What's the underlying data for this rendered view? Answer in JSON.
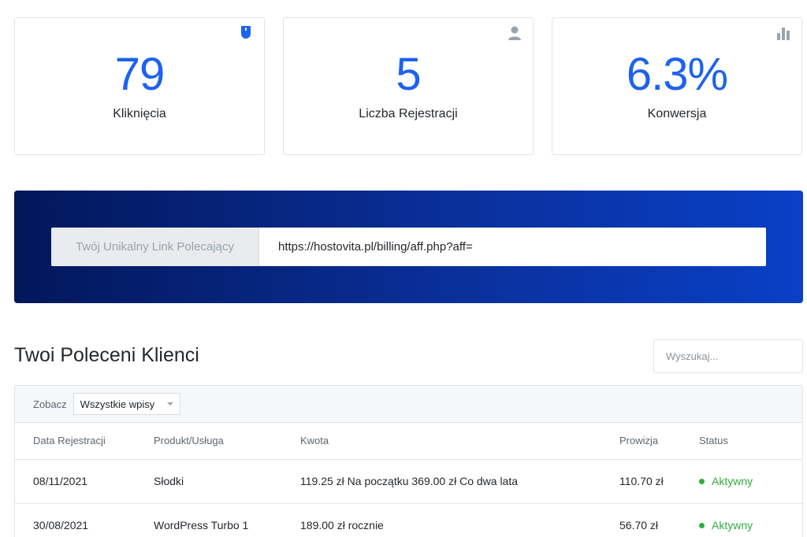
{
  "stats": [
    {
      "value": "79",
      "label": "Kliknięcia",
      "icon": "mouse-icon"
    },
    {
      "value": "5",
      "label": "Liczba Rejestracji",
      "icon": "user-icon"
    },
    {
      "value": "6.3%",
      "label": "Konwersja",
      "icon": "bar-chart-icon"
    }
  ],
  "referral": {
    "addon_label": "Twój Unikalny Link Polecający",
    "link": "https://hostovita.pl/billing/aff.php?aff="
  },
  "clients": {
    "title": "Twoi Poleceni Klienci",
    "search_placeholder": "Wyszukaj...",
    "show_label": "Zobacz",
    "show_selected": "Wszystkie wpisy",
    "columns": [
      "Data Rejestracji",
      "Produkt/Usługa",
      "Kwota",
      "Prowizja",
      "Status"
    ],
    "rows": [
      {
        "date": "08/11/2021",
        "product": "Słodki",
        "amount": "119.25 zł Na początku 369.00 zł Co dwa lata",
        "commission": "110.70 zł",
        "status": "Aktywny"
      },
      {
        "date": "30/08/2021",
        "product": "WordPress Turbo 1",
        "amount": "189.00 zł rocznie",
        "commission": "56.70 zł",
        "status": "Aktywny"
      }
    ]
  },
  "colors": {
    "accent": "#1d62f0",
    "status_active": "#2fae3e",
    "panel_gradient_start": "#02175a",
    "panel_gradient_end": "#0940c6"
  }
}
